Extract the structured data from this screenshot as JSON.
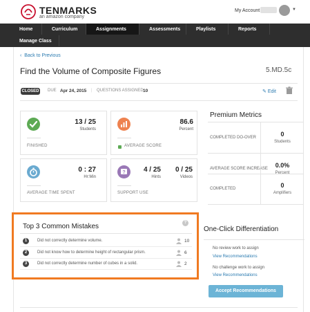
{
  "header": {
    "brand": "TENMARKS",
    "brand_sub": "an amazon company",
    "account_label": "My Account"
  },
  "nav": {
    "row1": [
      {
        "label": "Home"
      },
      {
        "label": "Curriculum"
      },
      {
        "label": "Assignments",
        "active": true
      },
      {
        "label": "Assessments"
      },
      {
        "label": "Playlists"
      },
      {
        "label": "Reports"
      }
    ],
    "row2": [
      {
        "label": "Manage Class"
      }
    ]
  },
  "assignment": {
    "back_link": "Back to Previous",
    "title": "Find the Volume of Composite Figures",
    "standard": "5.MD.5c",
    "status": "CLOSED",
    "due_label": "DUE",
    "due_value": "Apr 24, 2015",
    "separator": "|",
    "questions_label": "QUESTIONS ASSIGNED",
    "questions_value": "10",
    "edit_label": "Edit"
  },
  "stats": {
    "finished": {
      "value": "13 / 25",
      "unit": "Students",
      "label": "FINISHED",
      "icon": "checkmark-icon"
    },
    "average_score": {
      "value": "86.6",
      "unit": "Percent",
      "label": "AVERAGE SCORE",
      "icon": "bar-chart-icon"
    },
    "time_spent": {
      "value": "0 : 27",
      "unit": "Hr:Min",
      "label": "AVERAGE TIME SPENT",
      "icon": "stopwatch-icon"
    },
    "support_use": {
      "hints_value": "4 / 25",
      "hints_unit": "Hints",
      "videos_value": "0 / 25",
      "videos_unit": "Videos",
      "label": "SUPPORT USE",
      "icon": "question-icon"
    }
  },
  "premium": {
    "title": "Premium Metrics",
    "rows": [
      {
        "label": "COMPLETED DO-OVER",
        "value": "0",
        "unit": "Students"
      },
      {
        "label": "AVERAGE SCORE INCREASE",
        "value": "0.0%",
        "unit": "Percent"
      },
      {
        "label": "COMPLETED",
        "value": "0",
        "unit": "Amplifiers"
      }
    ]
  },
  "mistakes": {
    "title": "Top 3 Common Mistakes",
    "help": "?",
    "items": [
      {
        "num": "1",
        "text": "Did not correctly determine volume.",
        "count": "10"
      },
      {
        "num": "2",
        "text": "Did not know how to determine height of rectangular prism.",
        "count": "6"
      },
      {
        "num": "3",
        "text": "Did not correctly determine number of cubes in a solid.",
        "count": "2"
      }
    ]
  },
  "differentiation": {
    "title": "One-Click Differentiation",
    "review_text": "No review work to assign",
    "review_link": "View Recommendations",
    "challenge_text": "No challenge work to assign",
    "challenge_link": "View Recommendations",
    "button_label": "Accept Recommendations"
  },
  "colors": {
    "nav_bg": "#2e2e2e",
    "nav_active": "#161616",
    "link": "#2a7ab0",
    "highlight_border": "#f07a21",
    "button": "#6cb4d6",
    "finished_icon": "#5daa54",
    "score_icon": "#ee8250",
    "time_icon": "#6aaad0",
    "support_icon": "#9a78b6"
  }
}
